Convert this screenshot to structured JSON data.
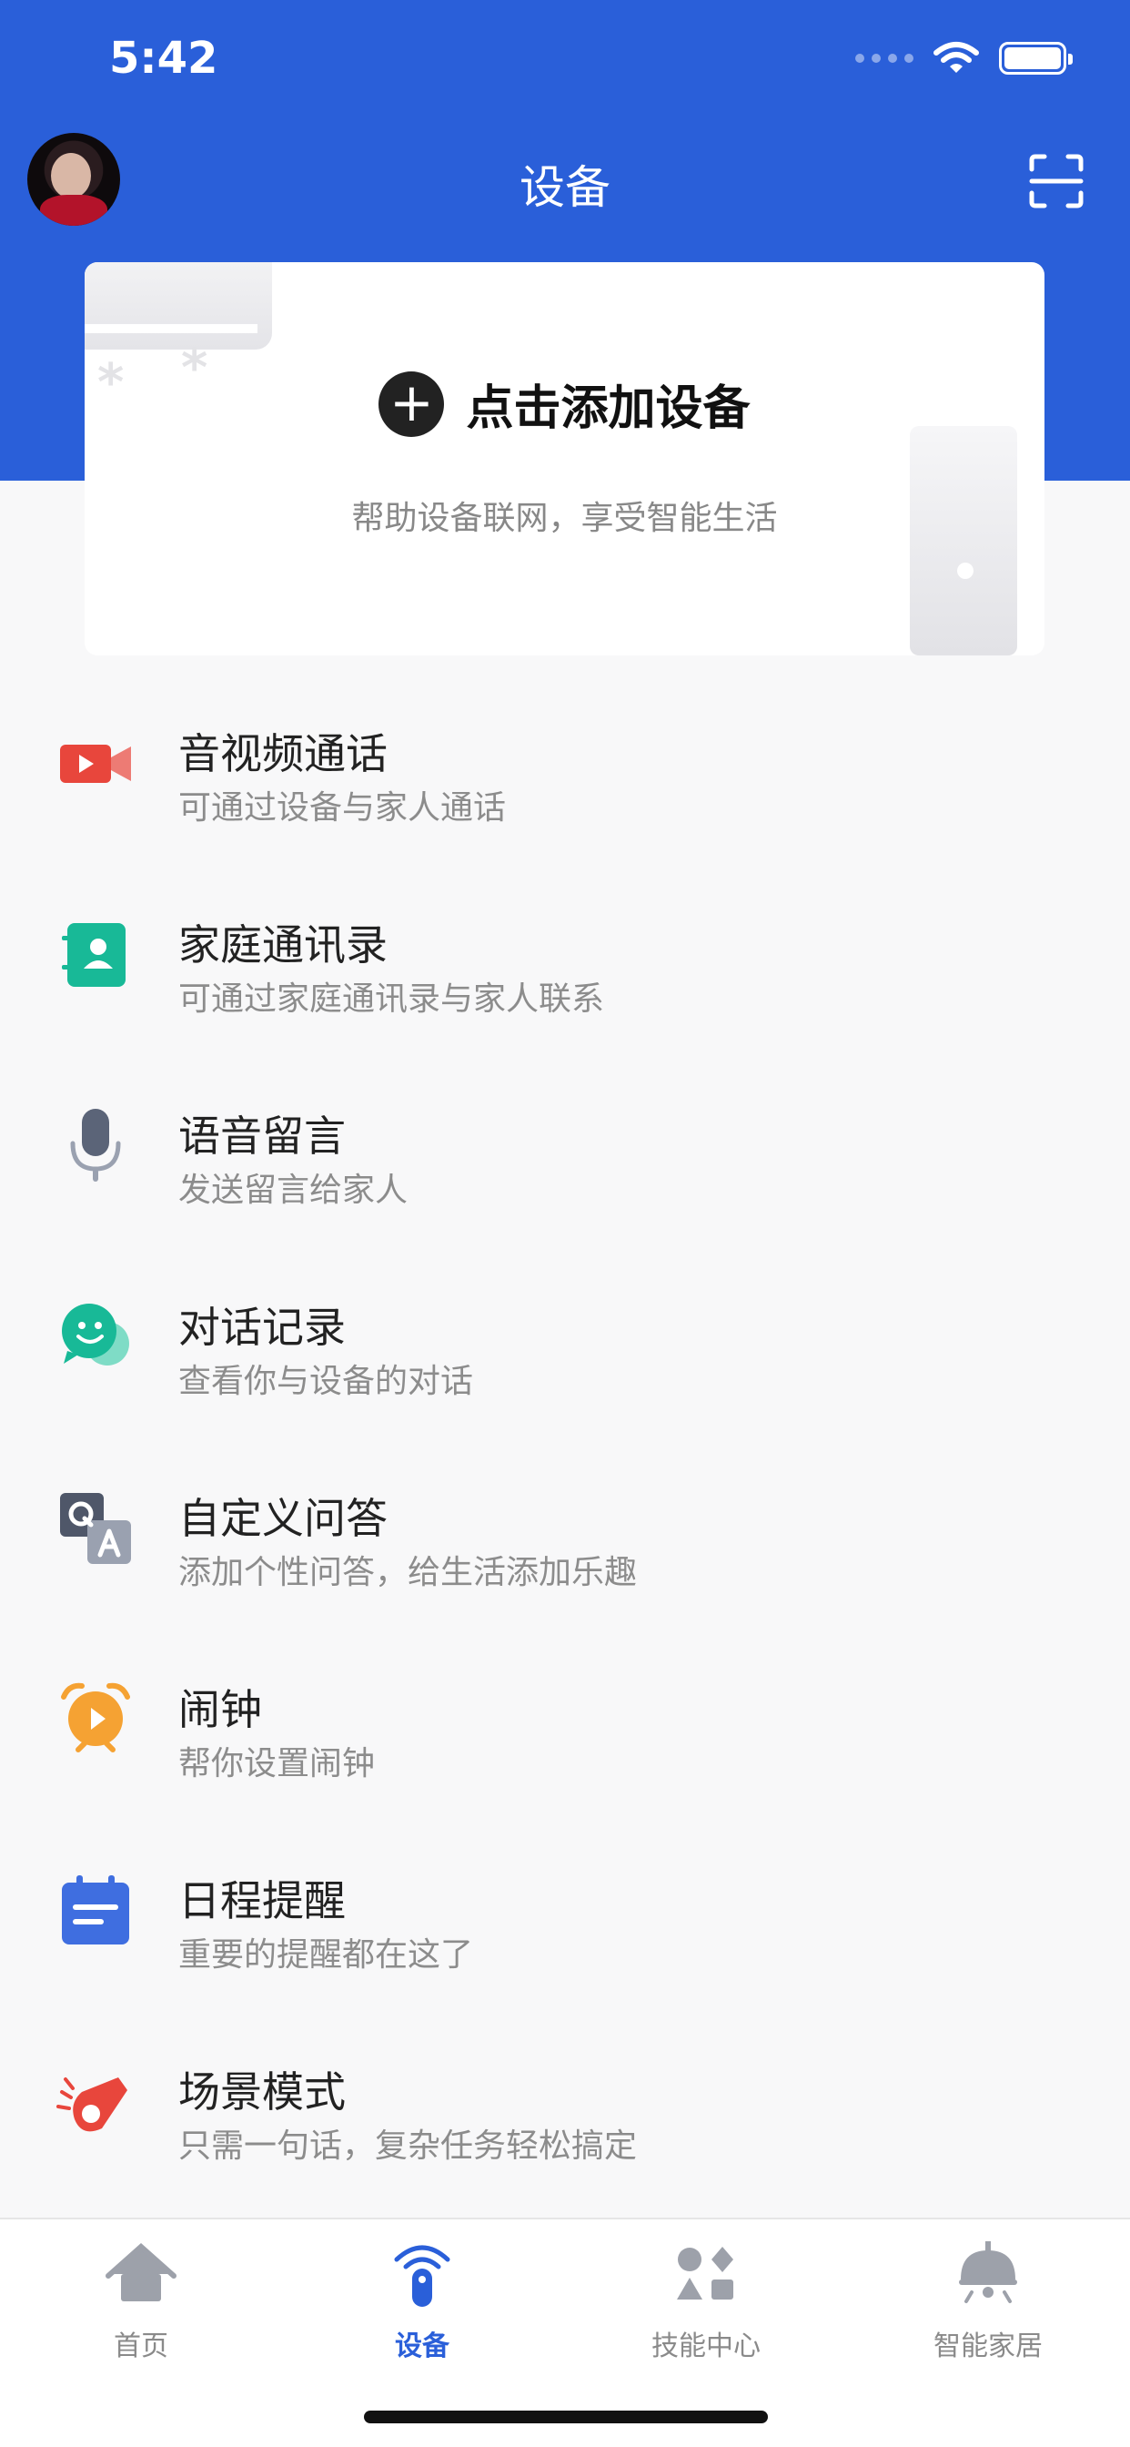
{
  "status_bar": {
    "time": "5:42"
  },
  "header": {
    "title": "设备"
  },
  "add_card": {
    "label": "点击添加设备",
    "subtitle": "帮助设备联网，享受智能生活"
  },
  "menu": [
    {
      "title": "音视频通话",
      "subtitle": "可通过设备与家人通话",
      "icon": "video-call-icon",
      "color": "#e8463c"
    },
    {
      "title": "家庭通讯录",
      "subtitle": "可通过家庭通讯录与家人联系",
      "icon": "contacts-icon",
      "color": "#18b997"
    },
    {
      "title": "语音留言",
      "subtitle": "发送留言给家人",
      "icon": "microphone-icon",
      "color": "#5b6478"
    },
    {
      "title": "对话记录",
      "subtitle": "查看你与设备的对话",
      "icon": "chat-icon",
      "color": "#18b997"
    },
    {
      "title": "自定义问答",
      "subtitle": "添加个性问答，给生活添加乐趣",
      "icon": "qa-icon",
      "color": "#5b6478"
    },
    {
      "title": "闹钟",
      "subtitle": "帮你设置闹钟",
      "icon": "alarm-icon",
      "color": "#f5a233"
    },
    {
      "title": "日程提醒",
      "subtitle": "重要的提醒都在这了",
      "icon": "calendar-icon",
      "color": "#3f6ee0"
    },
    {
      "title": "场景模式",
      "subtitle": "只需一句话，复杂任务轻松搞定",
      "icon": "scene-icon",
      "color": "#e8463c"
    }
  ],
  "tabbar": {
    "tabs": [
      {
        "label": "首页",
        "icon": "home-icon",
        "active": false
      },
      {
        "label": "设备",
        "icon": "device-icon",
        "active": true
      },
      {
        "label": "技能中心",
        "icon": "skills-icon",
        "active": false
      },
      {
        "label": "智能家居",
        "icon": "smart-home-icon",
        "active": false
      }
    ]
  },
  "colors": {
    "primary": "#2a5fd9",
    "background": "#f8f8f9"
  }
}
